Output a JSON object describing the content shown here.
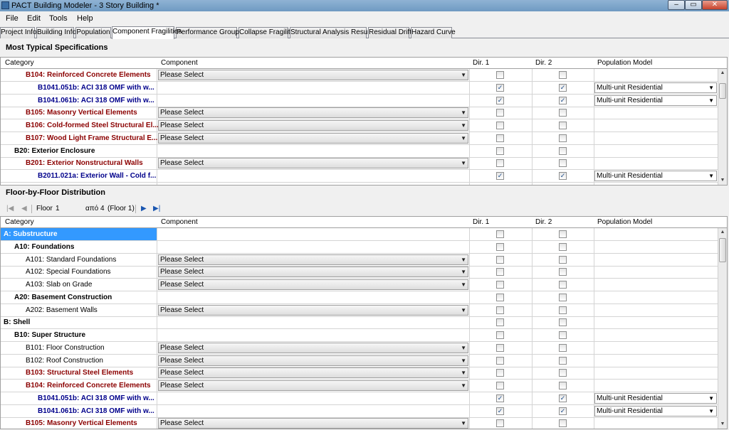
{
  "window": {
    "title": "PACT Building Modeler - 3 Story Building *"
  },
  "menu": [
    "File",
    "Edit",
    "Tools",
    "Help"
  ],
  "tabs": [
    "Project Info",
    "Building Info",
    "Population",
    "Component Fragilities",
    "Performance Groups",
    "Collapse Fragility",
    "Structural Analysis Results",
    "Residual Drift",
    "Hazard Curve"
  ],
  "active_tab": "Component Fragilities",
  "columns": {
    "category": "Category",
    "component": "Component",
    "dir1": "Dir. 1",
    "dir2": "Dir. 2",
    "population": "Population Model"
  },
  "typical": {
    "title": "Most Typical Specifications",
    "rows": [
      {
        "category": "B104: Reinforced Concrete Elements",
        "level": "l2b",
        "component": "Please Select",
        "dir1": false,
        "dir2": false,
        "population": ""
      },
      {
        "category": "B1041.051b: ACI 318 OMF with w...",
        "level": "l3",
        "component": "",
        "dir1": true,
        "dir2": true,
        "population": "Multi-unit Residential"
      },
      {
        "category": "B1041.061b: ACI 318 OMF with w...",
        "level": "l3",
        "component": "",
        "dir1": true,
        "dir2": true,
        "population": "Multi-unit Residential"
      },
      {
        "category": "B105: Masonry Vertical Elements",
        "level": "l2b",
        "component": "Please Select",
        "dir1": false,
        "dir2": false,
        "population": ""
      },
      {
        "category": "B106: Cold-formed Steel Structural El...",
        "level": "l2b",
        "component": "Please Select",
        "dir1": false,
        "dir2": false,
        "population": ""
      },
      {
        "category": "B107: Wood Light Frame Structural E...",
        "level": "l2b",
        "component": "Please Select",
        "dir1": false,
        "dir2": false,
        "population": ""
      },
      {
        "category": "B20: Exterior Enclosure",
        "level": "l1",
        "component": "",
        "dir1": false,
        "dir2": false,
        "population": ""
      },
      {
        "category": "B201: Exterior Nonstructural Walls",
        "level": "l2b",
        "component": "Please Select",
        "dir1": false,
        "dir2": false,
        "population": ""
      },
      {
        "category": "B2011.021a: Exterior Wall - Cold f...",
        "level": "l3",
        "component": "",
        "dir1": true,
        "dir2": true,
        "population": "Multi-unit Residential"
      }
    ]
  },
  "floor": {
    "title": "Floor-by-Floor Distribution",
    "nav": {
      "floor_label": "Floor",
      "floor_value": "1",
      "of_text": "από 4",
      "floor_name": "(Floor 1)"
    },
    "rows": [
      {
        "category": "A: Substructure",
        "level": "l0",
        "component": "",
        "dir1": false,
        "dir2": false,
        "population": "",
        "selected": true
      },
      {
        "category": "A10: Foundations",
        "level": "l1",
        "component": "",
        "dir1": false,
        "dir2": false,
        "population": ""
      },
      {
        "category": "A101: Standard Foundations",
        "level": "l2",
        "component": "Please Select",
        "dir1": false,
        "dir2": false,
        "population": ""
      },
      {
        "category": "A102: Special Foundations",
        "level": "l2",
        "component": "Please Select",
        "dir1": false,
        "dir2": false,
        "population": ""
      },
      {
        "category": "A103: Slab on Grade",
        "level": "l2",
        "component": "Please Select",
        "dir1": false,
        "dir2": false,
        "population": ""
      },
      {
        "category": "A20: Basement Construction",
        "level": "l1",
        "component": "",
        "dir1": false,
        "dir2": false,
        "population": ""
      },
      {
        "category": "A202: Basement Walls",
        "level": "l2",
        "component": "Please Select",
        "dir1": false,
        "dir2": false,
        "population": ""
      },
      {
        "category": "B: Shell",
        "level": "l0",
        "component": "",
        "dir1": false,
        "dir2": false,
        "population": ""
      },
      {
        "category": "B10: Super Structure",
        "level": "l1",
        "component": "",
        "dir1": false,
        "dir2": false,
        "population": ""
      },
      {
        "category": "B101: Floor Construction",
        "level": "l2",
        "component": "Please Select",
        "dir1": false,
        "dir2": false,
        "population": ""
      },
      {
        "category": "B102: Roof Construction",
        "level": "l2",
        "component": "Please Select",
        "dir1": false,
        "dir2": false,
        "population": ""
      },
      {
        "category": "B103: Structural Steel Elements",
        "level": "l2b",
        "component": "Please Select",
        "dir1": false,
        "dir2": false,
        "population": ""
      },
      {
        "category": "B104: Reinforced Concrete Elements",
        "level": "l2b",
        "component": "Please Select",
        "dir1": false,
        "dir2": false,
        "population": ""
      },
      {
        "category": "B1041.051b: ACI 318 OMF with w...",
        "level": "l3",
        "component": "",
        "dir1": true,
        "dir2": true,
        "population": "Multi-unit Residential"
      },
      {
        "category": "B1041.061b: ACI 318 OMF with w...",
        "level": "l3",
        "component": "",
        "dir1": true,
        "dir2": true,
        "population": "Multi-unit Residential"
      },
      {
        "category": "B105: Masonry Vertical Elements",
        "level": "l2b",
        "component": "Please Select",
        "dir1": false,
        "dir2": false,
        "population": ""
      }
    ]
  }
}
